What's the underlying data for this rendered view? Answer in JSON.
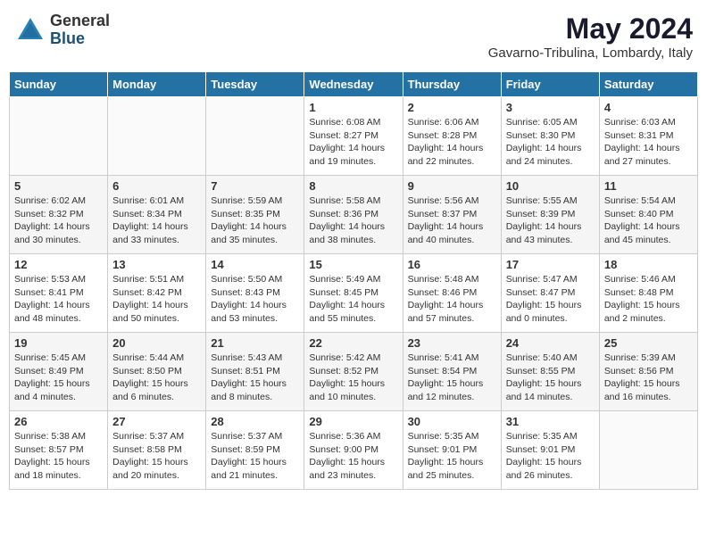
{
  "header": {
    "logo_line1": "General",
    "logo_line2": "Blue",
    "month": "May 2024",
    "location": "Gavarno-Tribulina, Lombardy, Italy"
  },
  "days_of_week": [
    "Sunday",
    "Monday",
    "Tuesday",
    "Wednesday",
    "Thursday",
    "Friday",
    "Saturday"
  ],
  "weeks": [
    [
      {
        "day": "",
        "info": ""
      },
      {
        "day": "",
        "info": ""
      },
      {
        "day": "",
        "info": ""
      },
      {
        "day": "1",
        "info": "Sunrise: 6:08 AM\nSunset: 8:27 PM\nDaylight: 14 hours and 19 minutes."
      },
      {
        "day": "2",
        "info": "Sunrise: 6:06 AM\nSunset: 8:28 PM\nDaylight: 14 hours and 22 minutes."
      },
      {
        "day": "3",
        "info": "Sunrise: 6:05 AM\nSunset: 8:30 PM\nDaylight: 14 hours and 24 minutes."
      },
      {
        "day": "4",
        "info": "Sunrise: 6:03 AM\nSunset: 8:31 PM\nDaylight: 14 hours and 27 minutes."
      }
    ],
    [
      {
        "day": "5",
        "info": "Sunrise: 6:02 AM\nSunset: 8:32 PM\nDaylight: 14 hours and 30 minutes."
      },
      {
        "day": "6",
        "info": "Sunrise: 6:01 AM\nSunset: 8:34 PM\nDaylight: 14 hours and 33 minutes."
      },
      {
        "day": "7",
        "info": "Sunrise: 5:59 AM\nSunset: 8:35 PM\nDaylight: 14 hours and 35 minutes."
      },
      {
        "day": "8",
        "info": "Sunrise: 5:58 AM\nSunset: 8:36 PM\nDaylight: 14 hours and 38 minutes."
      },
      {
        "day": "9",
        "info": "Sunrise: 5:56 AM\nSunset: 8:37 PM\nDaylight: 14 hours and 40 minutes."
      },
      {
        "day": "10",
        "info": "Sunrise: 5:55 AM\nSunset: 8:39 PM\nDaylight: 14 hours and 43 minutes."
      },
      {
        "day": "11",
        "info": "Sunrise: 5:54 AM\nSunset: 8:40 PM\nDaylight: 14 hours and 45 minutes."
      }
    ],
    [
      {
        "day": "12",
        "info": "Sunrise: 5:53 AM\nSunset: 8:41 PM\nDaylight: 14 hours and 48 minutes."
      },
      {
        "day": "13",
        "info": "Sunrise: 5:51 AM\nSunset: 8:42 PM\nDaylight: 14 hours and 50 minutes."
      },
      {
        "day": "14",
        "info": "Sunrise: 5:50 AM\nSunset: 8:43 PM\nDaylight: 14 hours and 53 minutes."
      },
      {
        "day": "15",
        "info": "Sunrise: 5:49 AM\nSunset: 8:45 PM\nDaylight: 14 hours and 55 minutes."
      },
      {
        "day": "16",
        "info": "Sunrise: 5:48 AM\nSunset: 8:46 PM\nDaylight: 14 hours and 57 minutes."
      },
      {
        "day": "17",
        "info": "Sunrise: 5:47 AM\nSunset: 8:47 PM\nDaylight: 15 hours and 0 minutes."
      },
      {
        "day": "18",
        "info": "Sunrise: 5:46 AM\nSunset: 8:48 PM\nDaylight: 15 hours and 2 minutes."
      }
    ],
    [
      {
        "day": "19",
        "info": "Sunrise: 5:45 AM\nSunset: 8:49 PM\nDaylight: 15 hours and 4 minutes."
      },
      {
        "day": "20",
        "info": "Sunrise: 5:44 AM\nSunset: 8:50 PM\nDaylight: 15 hours and 6 minutes."
      },
      {
        "day": "21",
        "info": "Sunrise: 5:43 AM\nSunset: 8:51 PM\nDaylight: 15 hours and 8 minutes."
      },
      {
        "day": "22",
        "info": "Sunrise: 5:42 AM\nSunset: 8:52 PM\nDaylight: 15 hours and 10 minutes."
      },
      {
        "day": "23",
        "info": "Sunrise: 5:41 AM\nSunset: 8:54 PM\nDaylight: 15 hours and 12 minutes."
      },
      {
        "day": "24",
        "info": "Sunrise: 5:40 AM\nSunset: 8:55 PM\nDaylight: 15 hours and 14 minutes."
      },
      {
        "day": "25",
        "info": "Sunrise: 5:39 AM\nSunset: 8:56 PM\nDaylight: 15 hours and 16 minutes."
      }
    ],
    [
      {
        "day": "26",
        "info": "Sunrise: 5:38 AM\nSunset: 8:57 PM\nDaylight: 15 hours and 18 minutes."
      },
      {
        "day": "27",
        "info": "Sunrise: 5:37 AM\nSunset: 8:58 PM\nDaylight: 15 hours and 20 minutes."
      },
      {
        "day": "28",
        "info": "Sunrise: 5:37 AM\nSunset: 8:59 PM\nDaylight: 15 hours and 21 minutes."
      },
      {
        "day": "29",
        "info": "Sunrise: 5:36 AM\nSunset: 9:00 PM\nDaylight: 15 hours and 23 minutes."
      },
      {
        "day": "30",
        "info": "Sunrise: 5:35 AM\nSunset: 9:01 PM\nDaylight: 15 hours and 25 minutes."
      },
      {
        "day": "31",
        "info": "Sunrise: 5:35 AM\nSunset: 9:01 PM\nDaylight: 15 hours and 26 minutes."
      },
      {
        "day": "",
        "info": ""
      }
    ]
  ]
}
